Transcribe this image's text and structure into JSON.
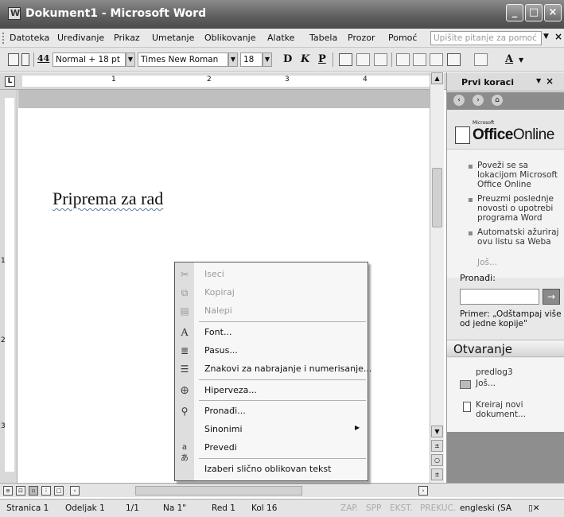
{
  "window": {
    "title": "Dokument1 - Microsoft Word"
  },
  "menu": {
    "items": [
      "Datoteka",
      "Uređivanje",
      "Prikaz",
      "Umetanje",
      "Oblikovanje",
      "Alatke",
      "Tabela",
      "Prozor",
      "Pomoć"
    ],
    "help_placeholder": "Upišite pitanje za pomoć"
  },
  "toolbar": {
    "style": "Normal + 18 pt",
    "font": "Times New Roman",
    "size": "18",
    "bold": "D",
    "italic": "K",
    "underline": "P",
    "font_color_letter": "A"
  },
  "ruler": {
    "numbers": [
      "1",
      "2",
      "3",
      "4"
    ],
    "vnumbers": [
      "1",
      "2",
      "3"
    ]
  },
  "document": {
    "heading": "Priprema za rad"
  },
  "context_menu": {
    "items": [
      {
        "label": "Iseci",
        "icon": "scissors-icon",
        "disabled": true
      },
      {
        "label": "Kopiraj",
        "icon": "copy-icon",
        "disabled": true
      },
      {
        "label": "Nalepi",
        "icon": "paste-icon",
        "disabled": true
      },
      {
        "label": "Font...",
        "icon": "font-icon",
        "disabled": false
      },
      {
        "label": "Pasus...",
        "icon": "paragraph-icon",
        "disabled": false
      },
      {
        "label": "Znakovi za nabrajanje i numerisanje...",
        "icon": "bullets-icon",
        "disabled": false
      },
      {
        "label": "Hiperveza...",
        "icon": "hyperlink-icon",
        "disabled": false
      },
      {
        "label": "Pronađi...",
        "icon": "find-icon",
        "disabled": false
      },
      {
        "label": "Sinonimi",
        "icon": "",
        "disabled": false,
        "submenu": true
      },
      {
        "label": "Prevedi",
        "icon": "translate-icon",
        "disabled": false
      },
      {
        "label": "Izaberi slično oblikovan tekst",
        "icon": "",
        "disabled": false
      }
    ]
  },
  "task_pane": {
    "title": "Prvi koraci",
    "logo_small": "Microsoft",
    "logo_office": "Office",
    "logo_online": "Online",
    "links": [
      "Poveži se sa lokacijom Microsoft Office Online",
      "Preuzmi poslednje novosti o upotrebi programa Word",
      "Automatski ažuriraj ovu listu sa Weba"
    ],
    "more": "Još...",
    "find_label": "Pronađi:",
    "example": "Primer: „Odštampaj više od jedne kopije\"",
    "open_section": "Otvaranje",
    "open_items": [
      "predlog3",
      "Još..."
    ],
    "new_doc": "Kreiraj novi dokument..."
  },
  "status": {
    "page": "Stranica 1",
    "section": "Odeljak 1",
    "pages": "1/1",
    "at": "Na 1\"",
    "line": "Red 1",
    "col": "Kol 16",
    "rec": "ZAP.",
    "trk": "SPP",
    "ext": "EKST.",
    "ovr": "PREKUC.",
    "lang": "engleski (SA"
  }
}
